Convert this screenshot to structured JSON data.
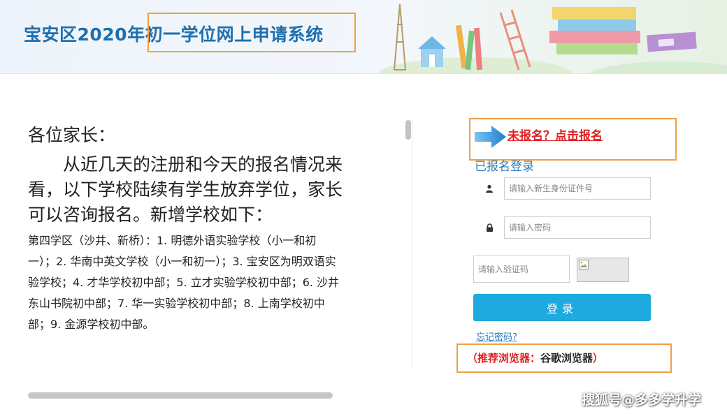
{
  "header": {
    "title_prefix": "宝安区2020年",
    "title_highlight": "初一学位网上申请系统"
  },
  "notice": {
    "greeting": "各位家长：",
    "body": "从近几天的注册和今天的报名情况来看，以下学校陆续有学生放弃学位，家长可以咨询报名。新增学校如下：",
    "schools": "第四学区（沙井、新桥）：1. 明德外语实验学校（小一和初一）；2. 华南中英文学校（小一和初一）；3. 宝安区为明双语实验学校；4. 才华学校初中部；5. 立才实验学校初中部；6. 沙井东山书院初中部；7. 华一实验学校初中部；8. 上南学校初中部；9. 金源学校初中部。"
  },
  "login": {
    "register_link": "未报名？点击报名",
    "registered_title": "已报名登录",
    "id_placeholder": "请输入新生身份证件号",
    "password_placeholder": "请输入密码",
    "captcha_placeholder": "请输入验证码",
    "login_button": "登录",
    "forgot_link": "忘记密码?",
    "browser_note_red": "（推荐浏览器：",
    "browser_note_dark": "谷歌浏览器",
    "browser_note_end": "）"
  },
  "watermark": "搜狐号@多多学升学",
  "colors": {
    "accent_blue": "#1ea9df",
    "title_blue": "#1f6fae",
    "link_red": "#e02020",
    "highlight_orange": "#f0a045"
  },
  "icons": {
    "arrow": "arrow-right-icon",
    "user": "user-icon",
    "lock": "lock-icon",
    "captcha": "broken-image-icon"
  }
}
